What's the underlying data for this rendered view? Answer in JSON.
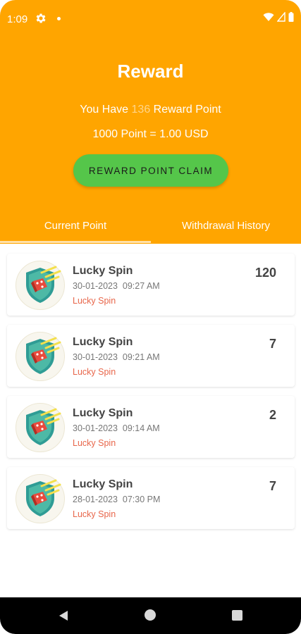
{
  "status_bar": {
    "time": "1:09",
    "icons": [
      "gear-icon",
      "dot-icon",
      "wifi-icon",
      "signal-icon",
      "battery-icon"
    ]
  },
  "header": {
    "title": "Reward",
    "points_prefix": "You Have",
    "points_value": "136",
    "points_suffix": "Reward Point",
    "conversion": "1000 Point = 1.00 USD",
    "claim_button": "REWARD POINT CLAIM",
    "background_color": "#FFA500",
    "button_color": "#55C64A"
  },
  "tabs": [
    {
      "label": "Current Point",
      "active": true
    },
    {
      "label": "Withdrawal History",
      "active": false
    }
  ],
  "entries": [
    {
      "title": "Lucky Spin",
      "date": "30-01-2023",
      "time": "09:27 AM",
      "source": "Lucky Spin",
      "points": "120"
    },
    {
      "title": "Lucky Spin",
      "date": "30-01-2023",
      "time": "09:21 AM",
      "source": "Lucky Spin",
      "points": "7"
    },
    {
      "title": "Lucky Spin",
      "date": "30-01-2023",
      "time": "09:14 AM",
      "source": "Lucky Spin",
      "points": "2"
    },
    {
      "title": "Lucky Spin",
      "date": "28-01-2023",
      "time": "07:30 PM",
      "source": "Lucky Spin",
      "points": "7"
    }
  ],
  "nav_bar": {
    "icons": [
      "back-icon",
      "home-icon",
      "recents-icon"
    ]
  }
}
